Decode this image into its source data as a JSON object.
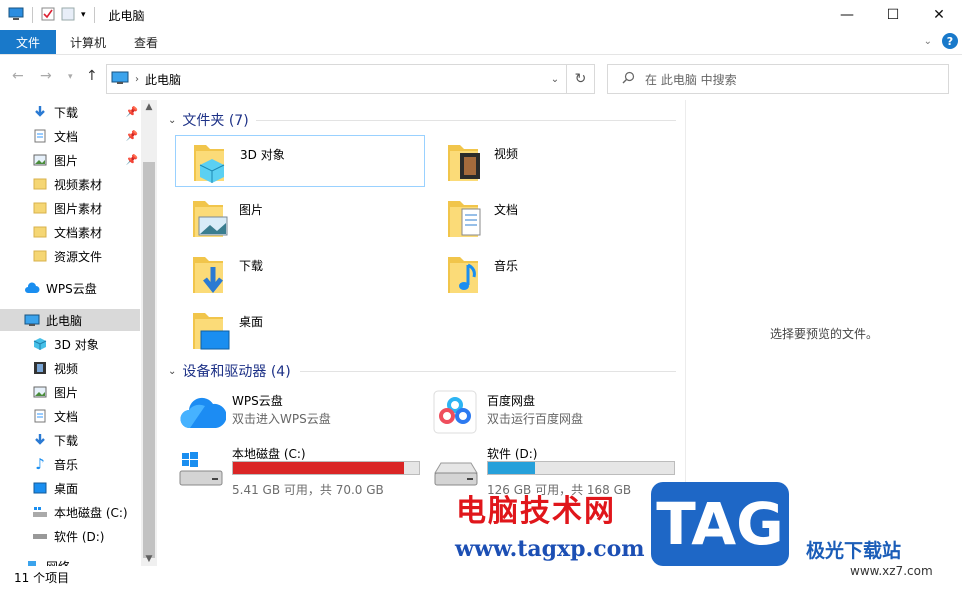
{
  "window": {
    "title": "此电脑",
    "controls": [
      "—",
      "☐",
      "✕"
    ]
  },
  "ribbon": {
    "file_tab": "文件",
    "tabs": [
      "计算机",
      "查看"
    ]
  },
  "address": {
    "breadcrumb": "此电脑",
    "search_placeholder": "在 此电脑 中搜索"
  },
  "sidebar": {
    "quick": [
      {
        "label": "下载",
        "icon": "download-icon",
        "pinned": true
      },
      {
        "label": "文档",
        "icon": "document-icon",
        "pinned": true
      },
      {
        "label": "图片",
        "icon": "picture-icon",
        "pinned": true
      },
      {
        "label": "视频素材",
        "icon": "folder-icon"
      },
      {
        "label": "图片素材",
        "icon": "folder-icon"
      },
      {
        "label": "文档素材",
        "icon": "folder-icon"
      },
      {
        "label": "资源文件",
        "icon": "folder-icon"
      }
    ],
    "cloud": {
      "label": "WPS云盘",
      "icon": "cloud-icon"
    },
    "this_pc": {
      "label": "此电脑",
      "icon": "computer-icon"
    },
    "pc_items": [
      {
        "label": "3D 对象",
        "icon": "cube-icon"
      },
      {
        "label": "视频",
        "icon": "video-icon"
      },
      {
        "label": "图片",
        "icon": "picture-icon"
      },
      {
        "label": "文档",
        "icon": "document-icon"
      },
      {
        "label": "下载",
        "icon": "download-icon"
      },
      {
        "label": "音乐",
        "icon": "music-icon"
      },
      {
        "label": "桌面",
        "icon": "desktop-icon"
      },
      {
        "label": "本地磁盘 (C:)",
        "icon": "windows-drive-icon"
      },
      {
        "label": "软件 (D:)",
        "icon": "drive-icon"
      },
      {
        "label": "网络",
        "icon": "network-icon"
      }
    ]
  },
  "main": {
    "folders_header": "文件夹 (7)",
    "folders": [
      {
        "label": "3D 对象",
        "icon": "cube-folder-icon"
      },
      {
        "label": "视频",
        "icon": "video-folder-icon"
      },
      {
        "label": "图片",
        "icon": "picture-folder-icon"
      },
      {
        "label": "文档",
        "icon": "document-folder-icon"
      },
      {
        "label": "下载",
        "icon": "download-folder-icon"
      },
      {
        "label": "音乐",
        "icon": "music-folder-icon"
      },
      {
        "label": "桌面",
        "icon": "desktop-folder-icon"
      }
    ],
    "devices_header": "设备和驱动器 (4)",
    "devices": [
      {
        "name": "WPS云盘",
        "sub": "双击进入WPS云盘",
        "icon": "wps-cloud-icon"
      },
      {
        "name": "百度网盘",
        "sub": "双击运行百度网盘",
        "icon": "baidu-netdisk-icon"
      },
      {
        "name": "本地磁盘 (C:)",
        "free": "5.41 GB 可用，共 70.0 GB",
        "used_fraction": 0.92,
        "bar_color": "#da2626",
        "icon": "windows-drive-icon"
      },
      {
        "name": "软件 (D:)",
        "free": "126 GB 可用，共 168 GB",
        "used_fraction": 0.25,
        "bar_color": "#26a0da",
        "icon": "drive-icon"
      }
    ]
  },
  "preview": {
    "text": "选择要预览的文件。"
  },
  "status": {
    "count": "11 个项目"
  },
  "watermarks": {
    "site_cn": "电脑技术网",
    "site_url": "www.tagxp.com",
    "tag": "TAG",
    "jiguang": "极光下载站",
    "jiguang_url": "www.xz7.com"
  }
}
